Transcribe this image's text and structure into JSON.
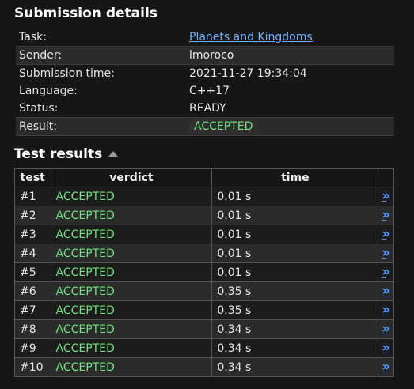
{
  "details": {
    "title": "Submission details",
    "rows": [
      {
        "key": "Task:",
        "value": "Planets and Kingdoms"
      },
      {
        "key": "Sender:",
        "value": "lmoroco"
      },
      {
        "key": "Submission time:",
        "value": "2021-11-27 19:34:04"
      },
      {
        "key": "Language:",
        "value": "C++17"
      },
      {
        "key": "Status:",
        "value": "READY"
      },
      {
        "key": "Result:",
        "value": "ACCEPTED"
      }
    ]
  },
  "tests": {
    "title": "Test results",
    "sort_icon": "triangle-up-icon",
    "columns": [
      "test",
      "verdict",
      "time",
      ""
    ],
    "rows": [
      {
        "test": "#1",
        "verdict": "ACCEPTED",
        "time": "0.01 s",
        "link": "»"
      },
      {
        "test": "#2",
        "verdict": "ACCEPTED",
        "time": "0.01 s",
        "link": "»"
      },
      {
        "test": "#3",
        "verdict": "ACCEPTED",
        "time": "0.01 s",
        "link": "»"
      },
      {
        "test": "#4",
        "verdict": "ACCEPTED",
        "time": "0.01 s",
        "link": "»"
      },
      {
        "test": "#5",
        "verdict": "ACCEPTED",
        "time": "0.01 s",
        "link": "»"
      },
      {
        "test": "#6",
        "verdict": "ACCEPTED",
        "time": "0.35 s",
        "link": "»"
      },
      {
        "test": "#7",
        "verdict": "ACCEPTED",
        "time": "0.35 s",
        "link": "»"
      },
      {
        "test": "#8",
        "verdict": "ACCEPTED",
        "time": "0.34 s",
        "link": "»"
      },
      {
        "test": "#9",
        "verdict": "ACCEPTED",
        "time": "0.34 s",
        "link": "»"
      },
      {
        "test": "#10",
        "verdict": "ACCEPTED",
        "time": "0.34 s",
        "link": "»"
      }
    ]
  },
  "colors": {
    "background": "#161616",
    "accepted": "#6fe07d",
    "link": "#6cb2ff",
    "row_alt": "#2b2b2b"
  }
}
